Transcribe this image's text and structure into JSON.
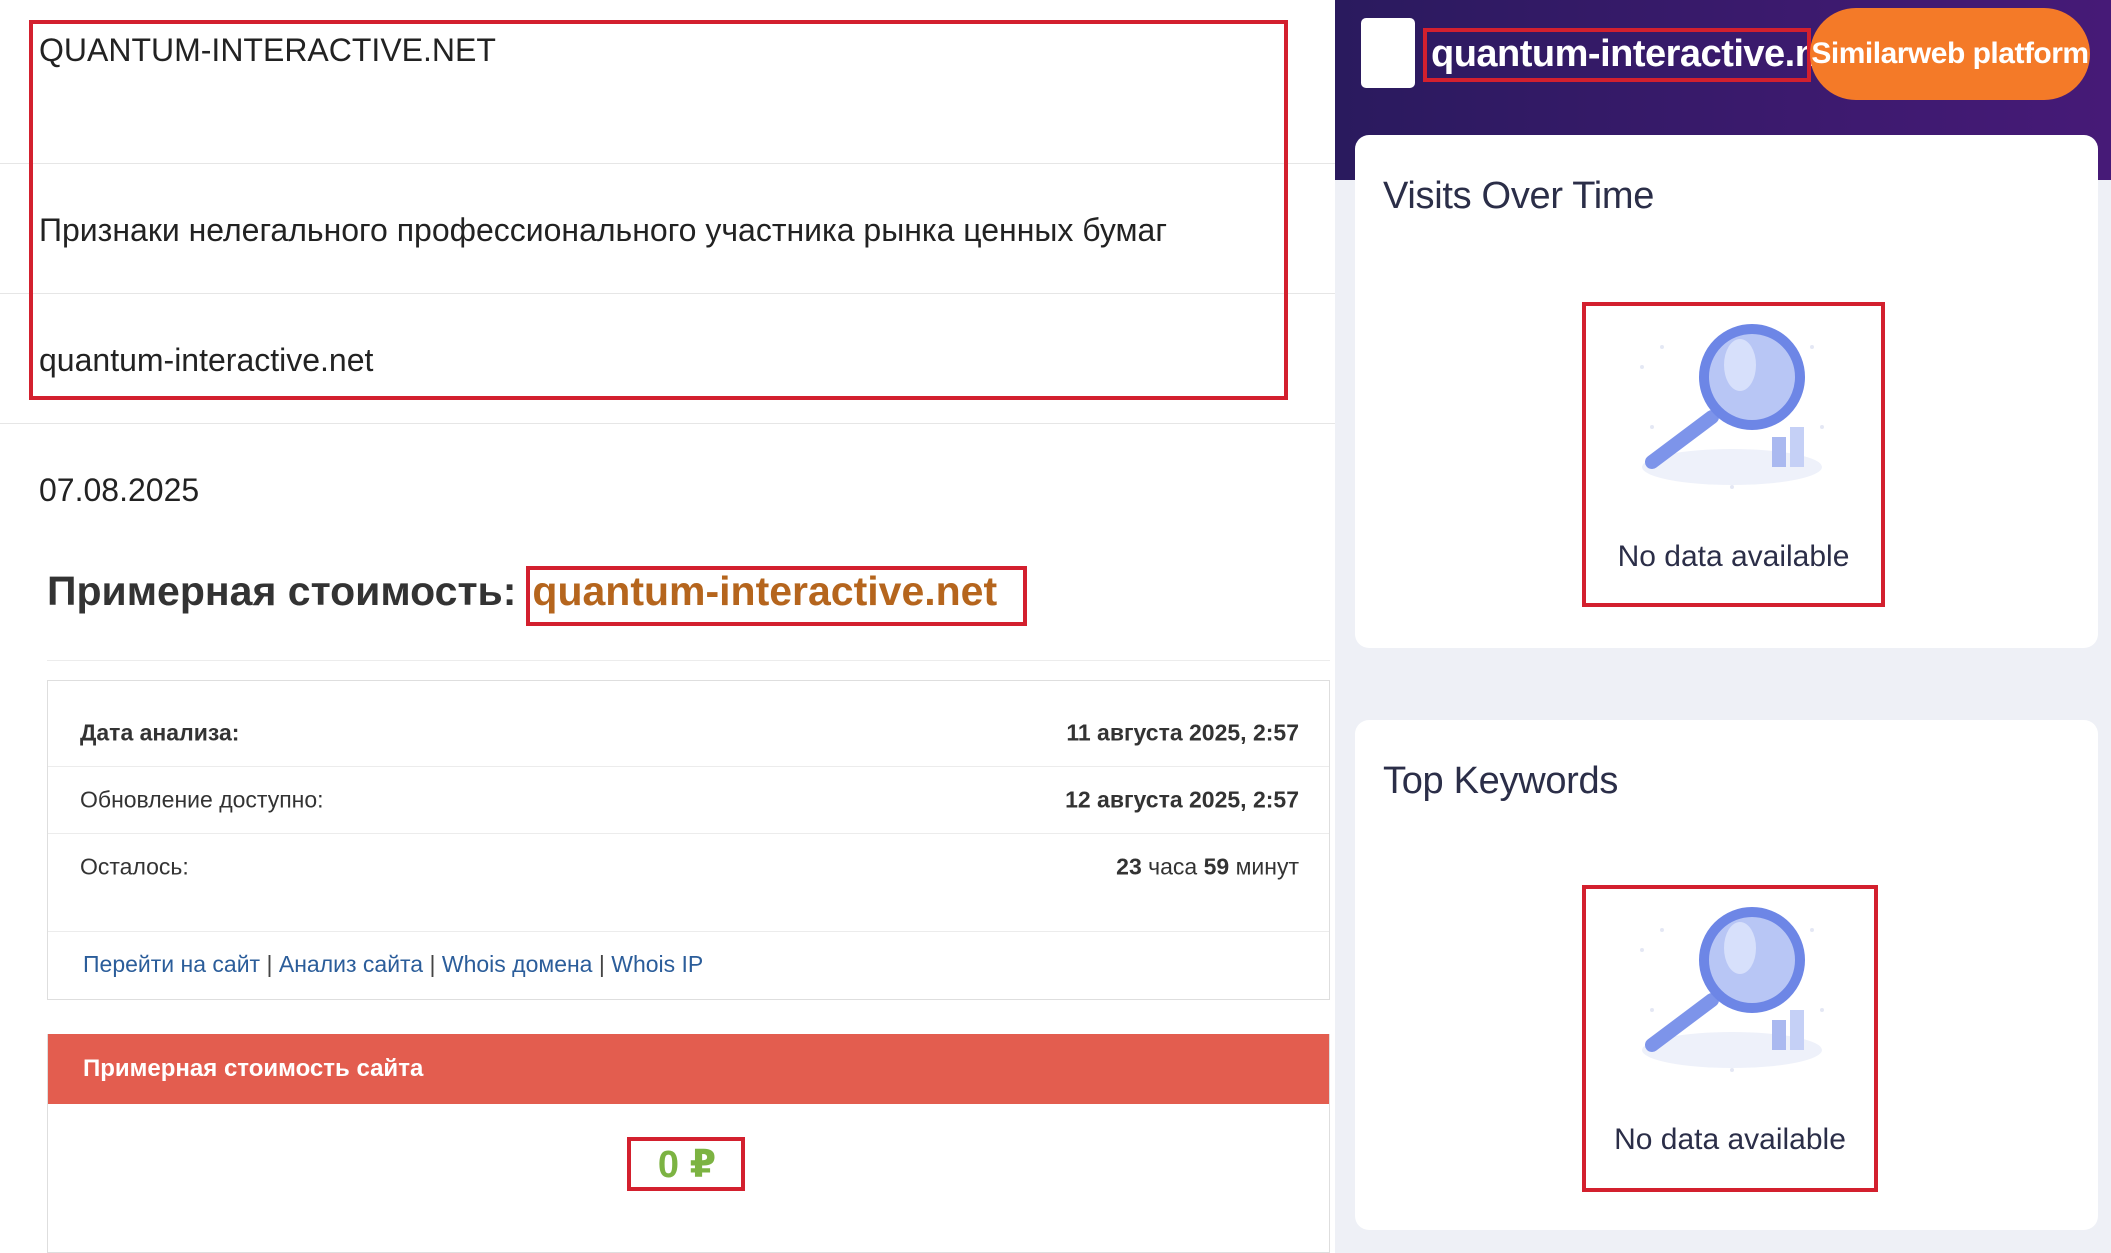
{
  "left": {
    "info": {
      "site_name_upper": "QUANTUM-INTERACTIVE.NET",
      "warning_text": "Признаки нелегального профессионального участника рынка ценных бумаг",
      "site_domain": "quantum-interactive.net"
    },
    "date": "07.08.2025",
    "cost_heading": {
      "label": "Примерная стоимость:",
      "domain": "quantum-interactive.net"
    },
    "details": {
      "analysis_date_label": "Дата анализа:",
      "analysis_date_value": "11 августа 2025, 2:57",
      "update_label": "Обновление доступно:",
      "update_value": "12 августа 2025, 2:57",
      "remaining_label": "Осталось:",
      "remaining_hours": "23",
      "remaining_hours_unit": "часа",
      "remaining_minutes": "59",
      "remaining_minutes_unit": "минут"
    },
    "links": {
      "goto_site": "Перейти на сайт",
      "site_analysis": "Анализ сайта",
      "whois_domain": "Whois домена",
      "whois_ip": "Whois IP",
      "separator": "|"
    },
    "value_panel": {
      "header": "Примерная стоимость сайта",
      "amount": "0 ₽"
    }
  },
  "right": {
    "domain_title": "quantum-interactive.net",
    "platform_button": "Similarweb platform",
    "visits_card": {
      "title": "Visits Over Time",
      "no_data": "No data available"
    },
    "keywords_card": {
      "title": "Top Keywords",
      "no_data": "No data available"
    }
  },
  "colors": {
    "highlight_border": "#d3202e",
    "cost_domain": "#b5651d",
    "value_header": "#e35d4f",
    "amount": "#7cb342",
    "link": "#2b5d9a",
    "platform_button": "#f47a28",
    "topbar": "#3c1a6e"
  }
}
